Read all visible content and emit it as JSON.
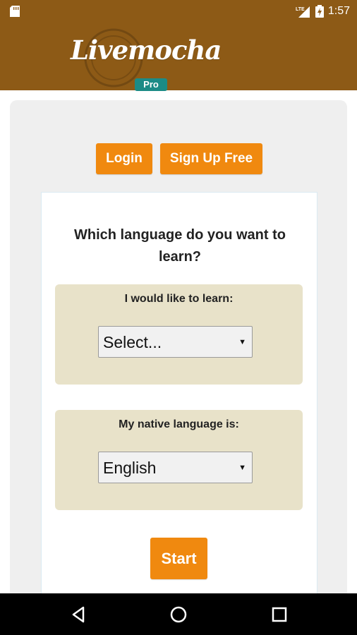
{
  "status_bar": {
    "time": "1:57",
    "icons": [
      "sd-card-icon",
      "lte-signal-icon",
      "battery-charging-icon"
    ],
    "network": "LTE"
  },
  "header": {
    "logo_text": "Livemocha",
    "badge": "Pro",
    "background": "#8d5a16"
  },
  "auth": {
    "login_label": "Login",
    "signup_label": "Sign Up Free"
  },
  "form": {
    "question": "Which language do you want to learn?",
    "learn": {
      "label": "I would like to learn:",
      "selected": "Select..."
    },
    "native": {
      "label": "My native language is:",
      "selected": "English"
    },
    "start_label": "Start"
  },
  "colors": {
    "accent": "#f0890f",
    "panel": "#e8e2c9",
    "header": "#8d5a16"
  },
  "nav": {
    "icons": [
      "back-icon",
      "home-icon",
      "recents-icon"
    ]
  }
}
